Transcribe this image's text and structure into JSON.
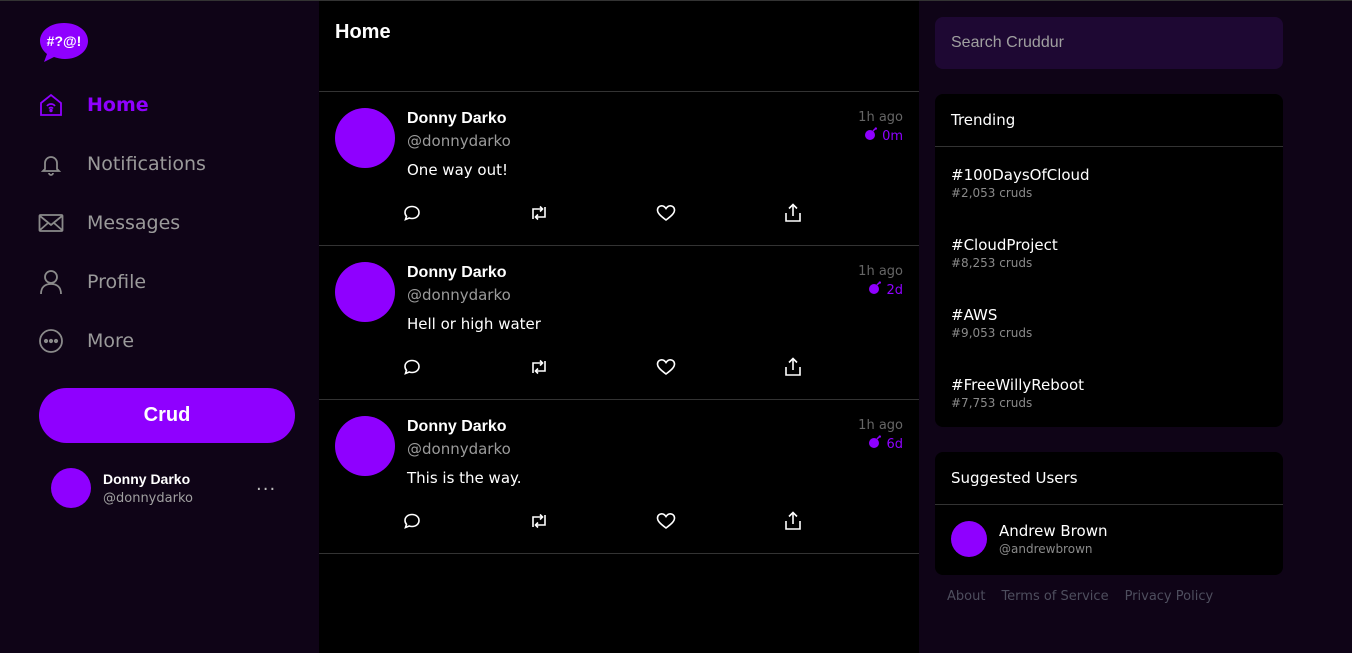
{
  "app": {
    "logo_text": "#?@!"
  },
  "nav": {
    "items": [
      {
        "label": "Home",
        "icon": "home-icon",
        "active": true
      },
      {
        "label": "Notifications",
        "icon": "bell-icon"
      },
      {
        "label": "Messages",
        "icon": "mail-icon"
      },
      {
        "label": "Profile",
        "icon": "person-icon"
      },
      {
        "label": "More",
        "icon": "more-circle-icon"
      }
    ],
    "crud_label": "Crud"
  },
  "current_user": {
    "name": "Donny Darko",
    "handle": "@donnydarko",
    "menu": "···"
  },
  "feed": {
    "title": "Home",
    "posts": [
      {
        "name": "Donny Darko",
        "handle": "@donnydarko",
        "message": "One way out!",
        "time": "1h ago",
        "expires": "0m"
      },
      {
        "name": "Donny Darko",
        "handle": "@donnydarko",
        "message": "Hell or high water",
        "time": "1h ago",
        "expires": "2d"
      },
      {
        "name": "Donny Darko",
        "handle": "@donnydarko",
        "message": "This is the way.",
        "time": "1h ago",
        "expires": "6d"
      }
    ]
  },
  "search": {
    "placeholder": "Search Cruddur"
  },
  "trending": {
    "title": "Trending",
    "items": [
      {
        "tag": "#100DaysOfCloud",
        "count": "#2,053 cruds"
      },
      {
        "tag": "#CloudProject",
        "count": "#8,253 cruds"
      },
      {
        "tag": "#AWS",
        "count": "#9,053 cruds"
      },
      {
        "tag": "#FreeWillyReboot",
        "count": "#7,753 cruds"
      }
    ]
  },
  "suggested": {
    "title": "Suggested Users",
    "users": [
      {
        "name": "Andrew Brown",
        "handle": "@andrewbrown"
      }
    ]
  },
  "footer": {
    "about": "About",
    "terms": "Terms of Service",
    "privacy": "Privacy Policy"
  },
  "colors": {
    "accent": "#8f00ff",
    "sidebar_bg": "#0f0417",
    "feed_bg": "#000000",
    "search_bg": "#1e0833"
  }
}
